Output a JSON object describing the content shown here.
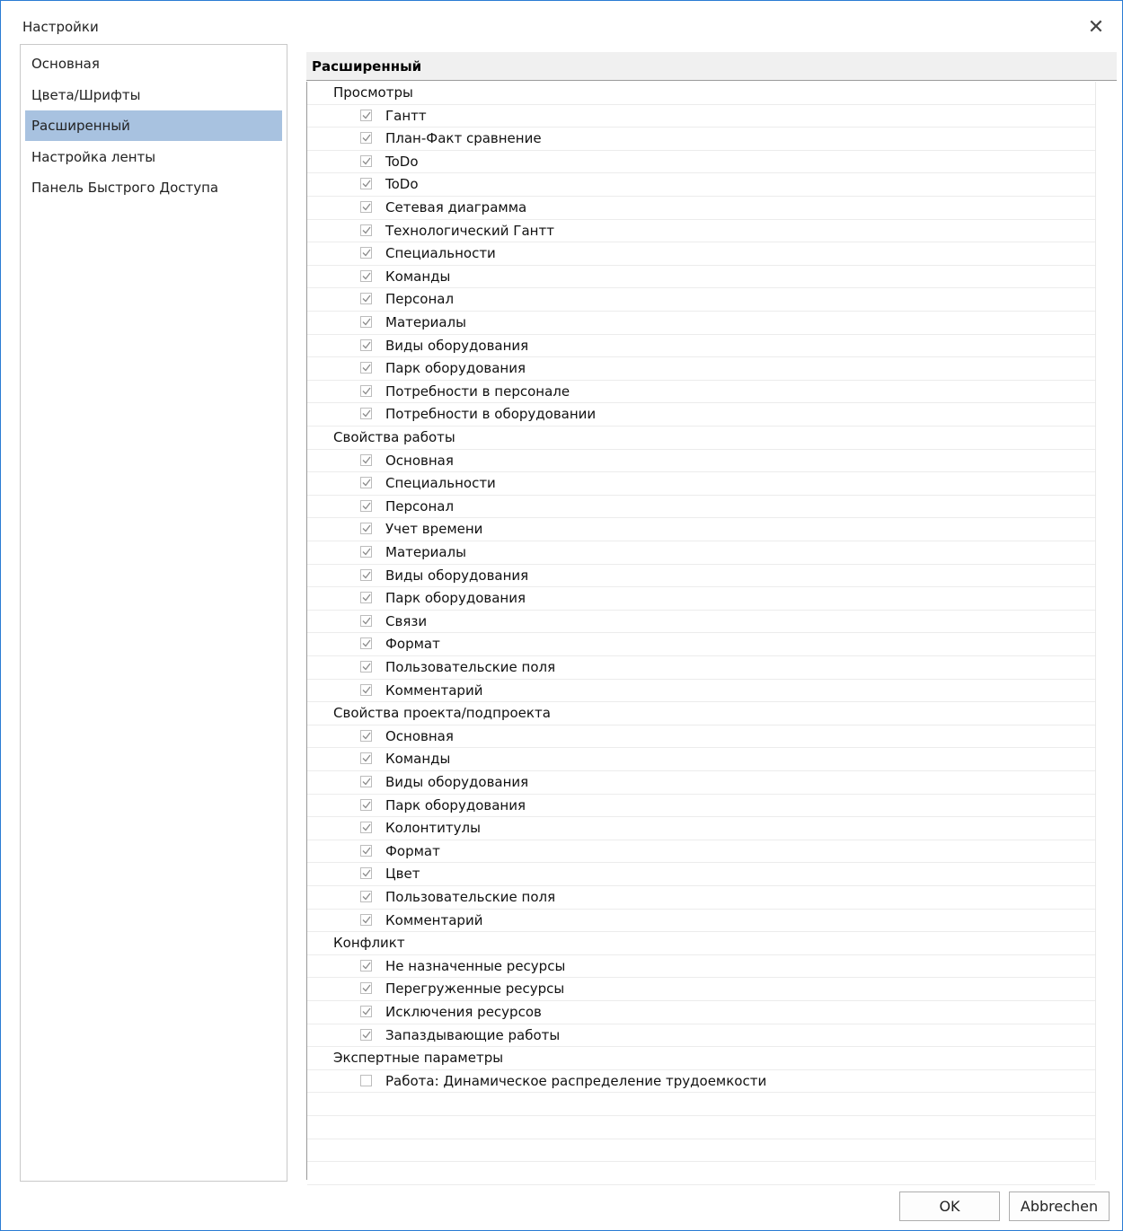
{
  "window": {
    "title": "Настройки",
    "close_icon": "close-icon"
  },
  "sidebar": {
    "items": [
      {
        "label": "Основная",
        "selected": false
      },
      {
        "label": "Цвета/Шрифты",
        "selected": false
      },
      {
        "label": "Расширенный",
        "selected": true
      },
      {
        "label": "Настройка ленты",
        "selected": false
      },
      {
        "label": "Панель Быстрого Доступа",
        "selected": false
      }
    ],
    "selected_color": "#a8c2e0"
  },
  "panel": {
    "header": "Расширенный",
    "groups": [
      {
        "label": "Просмотры",
        "items": [
          {
            "label": "Гантт",
            "checked": true
          },
          {
            "label": "План-Факт сравнение",
            "checked": true
          },
          {
            "label": "ToDo",
            "checked": true
          },
          {
            "label": "ToDo",
            "checked": true
          },
          {
            "label": "Сетевая диаграмма",
            "checked": true
          },
          {
            "label": "Технологический Гантт",
            "checked": true
          },
          {
            "label": "Специальности",
            "checked": true
          },
          {
            "label": "Команды",
            "checked": true
          },
          {
            "label": "Персонал",
            "checked": true
          },
          {
            "label": "Материалы",
            "checked": true
          },
          {
            "label": "Виды оборудования",
            "checked": true
          },
          {
            "label": "Парк оборудования",
            "checked": true
          },
          {
            "label": "Потребности в персонале",
            "checked": true
          },
          {
            "label": "Потребности в оборудовании",
            "checked": true
          }
        ]
      },
      {
        "label": "Свойства работы",
        "items": [
          {
            "label": "Основная",
            "checked": true
          },
          {
            "label": "Специальности",
            "checked": true
          },
          {
            "label": "Персонал",
            "checked": true
          },
          {
            "label": "Учет времени",
            "checked": true
          },
          {
            "label": "Материалы",
            "checked": true
          },
          {
            "label": "Виды оборудования",
            "checked": true
          },
          {
            "label": "Парк оборудования",
            "checked": true
          },
          {
            "label": "Связи",
            "checked": true
          },
          {
            "label": "Формат",
            "checked": true
          },
          {
            "label": "Пользовательские поля",
            "checked": true
          },
          {
            "label": "Комментарий",
            "checked": true
          }
        ]
      },
      {
        "label": "Свойства проекта/подпроекта",
        "items": [
          {
            "label": "Основная",
            "checked": true
          },
          {
            "label": "Команды",
            "checked": true
          },
          {
            "label": "Виды оборудования",
            "checked": true
          },
          {
            "label": "Парк оборудования",
            "checked": true
          },
          {
            "label": "Колонтитулы",
            "checked": true
          },
          {
            "label": "Формат",
            "checked": true
          },
          {
            "label": "Цвет",
            "checked": true
          },
          {
            "label": "Пользовательские поля",
            "checked": true
          },
          {
            "label": "Комментарий",
            "checked": true
          }
        ]
      },
      {
        "label": "Конфликт",
        "items": [
          {
            "label": "Не назначенные ресурсы",
            "checked": true
          },
          {
            "label": "Перегруженные ресурсы",
            "checked": true
          },
          {
            "label": "Исключения ресурсов",
            "checked": true
          },
          {
            "label": "Запаздывающие работы",
            "checked": true
          }
        ]
      },
      {
        "label": "Экспертные параметры",
        "items": [
          {
            "label": "Работа: Динамическое распределение трудоемкости",
            "checked": false
          }
        ]
      }
    ],
    "empty_rows": 4
  },
  "buttons": {
    "ok": "OK",
    "cancel": "Abbrechen"
  }
}
